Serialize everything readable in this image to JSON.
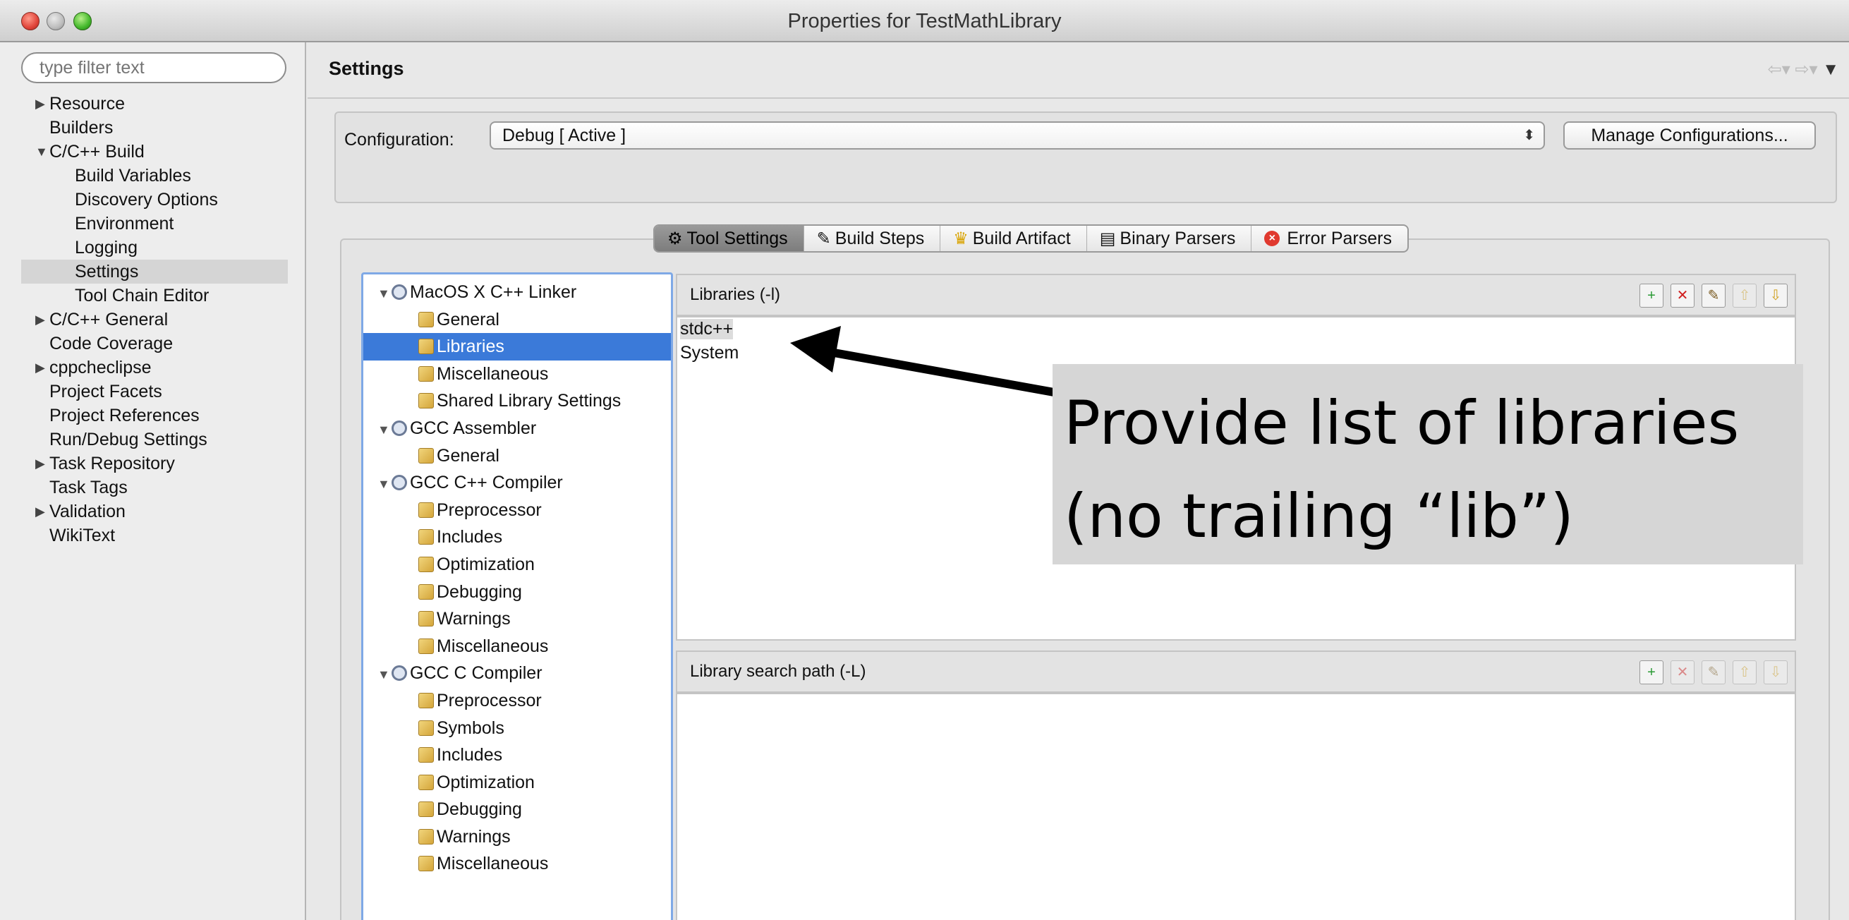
{
  "window": {
    "title": "Properties for TestMathLibrary"
  },
  "sidebar": {
    "filter_placeholder": "type filter text",
    "items": [
      {
        "label": "Resource",
        "expander": "▶"
      },
      {
        "label": "Builders"
      },
      {
        "label": "C/C++ Build",
        "expander": "▼"
      },
      {
        "label": "Build Variables"
      },
      {
        "label": "Discovery Options"
      },
      {
        "label": "Environment"
      },
      {
        "label": "Logging"
      },
      {
        "label": "Settings",
        "selected": true
      },
      {
        "label": "Tool Chain Editor"
      },
      {
        "label": "C/C++ General",
        "expander": "▶"
      },
      {
        "label": "Code Coverage"
      },
      {
        "label": "cppcheclipse",
        "expander": "▶"
      },
      {
        "label": "Project Facets"
      },
      {
        "label": "Project References"
      },
      {
        "label": "Run/Debug Settings"
      },
      {
        "label": "Task Repository",
        "expander": "▶"
      },
      {
        "label": "Task Tags"
      },
      {
        "label": "Validation",
        "expander": "▶"
      },
      {
        "label": "WikiText"
      }
    ]
  },
  "main": {
    "title": "Settings",
    "config_label": "Configuration:",
    "config_value": "Debug  [ Active ]",
    "manage_button": "Manage Configurations...",
    "tabs": [
      {
        "label": "Tool Settings",
        "icon": "tool-settings-icon"
      },
      {
        "label": "Build Steps",
        "icon": "build-steps-icon"
      },
      {
        "label": "Build Artifact",
        "icon": "build-artifact-icon"
      },
      {
        "label": "Binary Parsers",
        "icon": "binary-parsers-icon"
      },
      {
        "label": "Error Parsers",
        "icon": "error-parsers-icon"
      }
    ],
    "tree": [
      {
        "label": "MacOS X C++ Linker"
      },
      {
        "label": "General"
      },
      {
        "label": "Libraries",
        "selected": true
      },
      {
        "label": "Miscellaneous"
      },
      {
        "label": "Shared Library Settings"
      },
      {
        "label": "GCC Assembler"
      },
      {
        "label": "General"
      },
      {
        "label": "GCC C++ Compiler"
      },
      {
        "label": "Preprocessor"
      },
      {
        "label": "Includes"
      },
      {
        "label": "Optimization"
      },
      {
        "label": "Debugging"
      },
      {
        "label": "Warnings"
      },
      {
        "label": "Miscellaneous"
      },
      {
        "label": "GCC C Compiler"
      },
      {
        "label": "Preprocessor"
      },
      {
        "label": "Symbols"
      },
      {
        "label": "Includes"
      },
      {
        "label": "Optimization"
      },
      {
        "label": "Debugging"
      },
      {
        "label": "Warnings"
      },
      {
        "label": "Miscellaneous"
      }
    ],
    "libraries": {
      "label": "Libraries (-l)",
      "items": [
        "stdc++",
        "System"
      ]
    },
    "search_path": {
      "label": "Library search path (-L)"
    }
  },
  "callout": {
    "line1": "Provide list of libraries",
    "line2": "(no trailing “lib”)"
  }
}
